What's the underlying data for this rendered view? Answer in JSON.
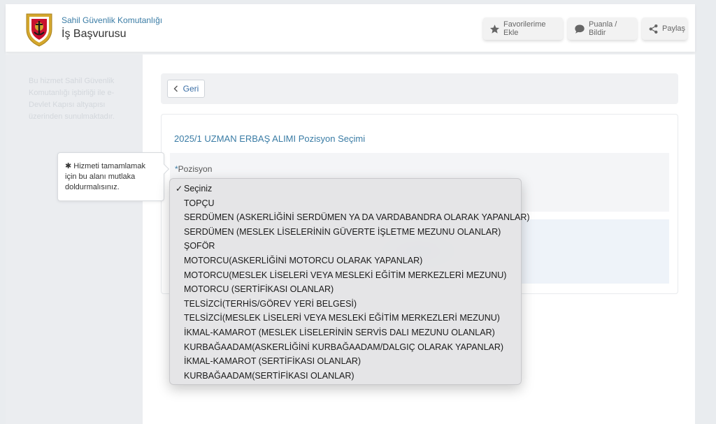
{
  "header": {
    "org_name": "Sahil Güvenlik Komutanlığı",
    "service_title": "İş Başvurusu",
    "buttons": {
      "favorites": "Favorilerime Ekle",
      "rate": "Puanla / Bildir",
      "share": "Paylaş"
    }
  },
  "sidebar": {
    "note": "Bu hizmet Sahil Güvenlik Komutanlığı işbirliği ile e-Devlet Kapısı altyapısı üzerinden sunulmaktadır."
  },
  "main": {
    "back_label": "Geri",
    "section_title": "2025/1 UZMAN ERBAŞ ALIMI Pozisyon Seçimi",
    "field": {
      "required_mark": "*",
      "label": "Pozisyon"
    }
  },
  "tooltip": {
    "text": "✱ Hizmeti tamamlamak için bu alanı mutlaka doldurmalısınız."
  },
  "dropdown": {
    "selected_index": 0,
    "options": [
      "Seçiniz",
      "TOPÇU",
      "SERDÜMEN (ASKERLİĞİNİ SERDÜMEN YA DA VARDABANDRA OLARAK YAPANLAR)",
      "SERDÜMEN (MESLEK LİSELERİNİN GÜVERTE İŞLETME MEZUNU OLANLAR)",
      "ŞOFÖR",
      "MOTORCU(ASKERLİĞİNİ MOTORCU OLARAK YAPANLAR)",
      "MOTORCU(MESLEK LİSELERİ VEYA MESLEKİ EĞİTİM MERKEZLERİ MEZUNU)",
      "MOTORCU (SERTİFİKASI OLANLAR)",
      "TELSİZCİ(TERHİS/GÖREV YERİ BELGESİ)",
      "TELSİZCİ(MESLEK LİSELERİ VEYA MESLEKİ EĞİTİM MERKEZLERİ MEZUNU)",
      "İKMAL-KAMAROT (MESLEK LİSELERİNİN SERVİS DALI MEZUNU OLANLAR)",
      "KURBAĞAADAM(ASKERLİĞİNİ KURBAĞAADAM/DALGIÇ OLARAK YAPANLAR)",
      "İKMAL-KAMAROT (SERTİFİKASI OLANLAR)",
      "KURBAĞAADAM(SERTİFİKASI OLANLAR)"
    ]
  },
  "colors": {
    "accent": "#3a7ca5",
    "logo_red": "#c8102e",
    "logo_gold": "#d4a72c"
  }
}
